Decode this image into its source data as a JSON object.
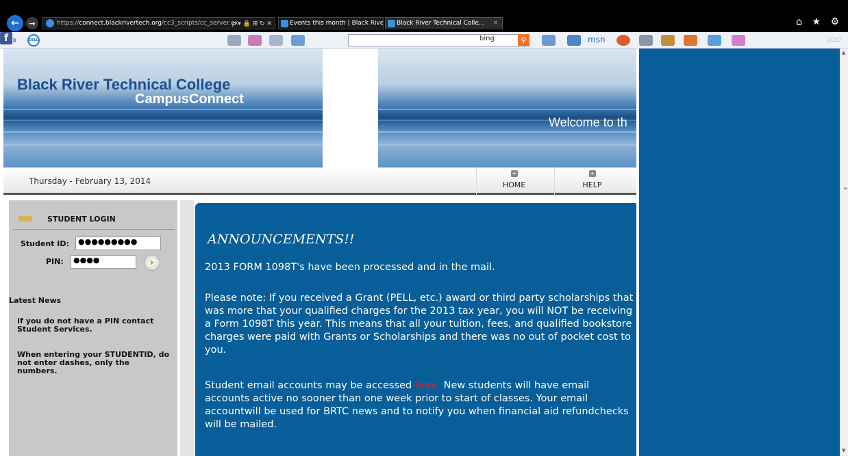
{
  "browser": {
    "address_domain": "connect.blackrivertech.org",
    "address_prefix": "https://",
    "address_suffix": "/cc3_scripts/cc_server.ex",
    "address_icons": "ρ ▾ 🔒 ⊞ ↻ ✕",
    "tabs": [
      {
        "title": "Events this month | Black River..."
      },
      {
        "title": "Black River Technical Colle...",
        "close": "✕"
      }
    ],
    "window_icons": "⌂ ★ ⚙",
    "toolbar": {
      "close_x": "x",
      "dell_label": "DELL",
      "facebook_label": "f",
      "bing_label": "bing",
      "msn_label": "msn",
      "search_value": ""
    }
  },
  "banner": {
    "college_name": "Black River Technical College",
    "subtitle": "CampusConnect",
    "welcome": "Welcome to th"
  },
  "datebar": {
    "date": "Thursday - February 13, 2014",
    "nav": [
      {
        "label": "HOME"
      },
      {
        "label": "HELP"
      }
    ]
  },
  "login": {
    "title": "STUDENT LOGIN",
    "student_id_label": "Student ID:",
    "student_id_value": "●●●●●●●●●",
    "pin_label": "PIN:",
    "pin_value": "●●●●"
  },
  "news": {
    "heading": "Latest News",
    "items": [
      "If you do not have a PIN contact Student Services.",
      "When entering your STUDENTID, do not enter dashes, only the numbers."
    ]
  },
  "announcements": {
    "title": "ANNOUNCEMENTS!!",
    "p1": "2013 FORM 1098T's have been processed and in the mail.",
    "p2": "Please note: If you received a Grant (PELL, etc.) award or third party scholarships that was more that your qualified charges for the 2013 tax year, you will NOT be receiving a Form 1098T this year. This means that all your tuition, fees, and qualified bookstore charges were paid with Grants or Scholarships and there was no out of pocket cost to you.",
    "p3_before": "Student email accounts may be accessed ",
    "p3_link": "here.",
    "p3_after": " New students will have email accounts active no sooner than one week prior to start of classes. Your email accountwill be used for BRTC news and to notify you when financial aid refundchecks will be mailed."
  },
  "colors": {
    "page_blue": "#075e98",
    "link_red": "#e02020",
    "college_blue": "#1d4f8e"
  }
}
